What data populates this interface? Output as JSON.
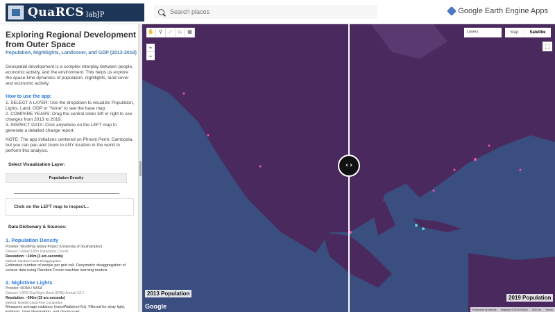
{
  "header": {
    "logo_text": "QuaRCS",
    "logo_sub": "labJP",
    "search_placeholder": "Search places",
    "gee_label": "Google Earth Engine Apps"
  },
  "sidebar": {
    "title": "Exploring Regional Development from Outer Space",
    "subtitle": "Population, Nightlights, Landcover, and GDP (2013-2019)",
    "intro": "Geospatial development is a complex interplay between people, economic activity, and the environment. This helps us explore the space-time dynamics of population, nightlights, land cover and economic activity.",
    "how_heading": "How to use the app:",
    "step1": "1. SELECT A LAYER: Use the dropdown to visualize Population, Lights, Land, GDP or \"None\" to see the base map.",
    "step2": "2. COMPARE YEARS: Drag the central slider left or right to see changes from 2013 to 2019.",
    "step3": "3. INSPECT DATA: Click anywhere on the LEFT map to generate a detailed change report.",
    "note": "NOTE: The app initializes centered on Phnom Penh, Cambodia, but you can pan and zoom to ANY location in the world to perform this analysis.",
    "select_label": "Select Visualization Layer:",
    "select_value": "Population Density",
    "click_prompt": "Click on the LEFT map to inspect...",
    "dictionary_title": "Data Dictionary & Sources:",
    "source1": {
      "heading": "1. Population Density",
      "provider": "Provider: WorldPop Global Project (University of Southampton)",
      "dataset": "Dataset: Global 100m Population Counts",
      "resolution": "Resolution: ~100m (3 arc-seconds)",
      "method": "Method: Random Forest Disaggregation",
      "description": "Estimated number of people per grid cell. Dasymetric disaggregation of census data using Random Forest machine learning models."
    },
    "source2": {
      "heading": "2. Nighttime Lights",
      "provider": "Provider: NOAA / NASA",
      "dataset": "Dataset: VIIRS Day/Night Band (DNB) Annual V2.1",
      "resolution": "Resolution: ~500m (15 arc-seconds)",
      "method": "Method: Monthly Cloud-Free Composites",
      "description": "Measures average radiance (nanoWatts/cm²/sr). Filtered for stray light, lightning, lunar illumination, and cloud-cover."
    }
  },
  "map": {
    "tools": [
      "✋",
      "⚲",
      "⟋",
      "⏢",
      "▦"
    ],
    "zoom_in": "+",
    "zoom_out": "−",
    "layers_label": "Layers",
    "maptype_map": "Map",
    "maptype_satellite": "Satellite",
    "fullscreen": "⛶",
    "slider_glyph": "‹›",
    "left_label": "2013 Population",
    "right_label": "2019 Population",
    "google": "Google",
    "attribution": [
      "Keyboard shortcuts",
      "Imagery ©2026 NASA",
      "500 km",
      "Terms"
    ]
  },
  "colors": {
    "ocean": "#3a4f80",
    "land": "#4a2a5e",
    "header_bg": "#1d3557",
    "accent": "#2a7ad6"
  }
}
